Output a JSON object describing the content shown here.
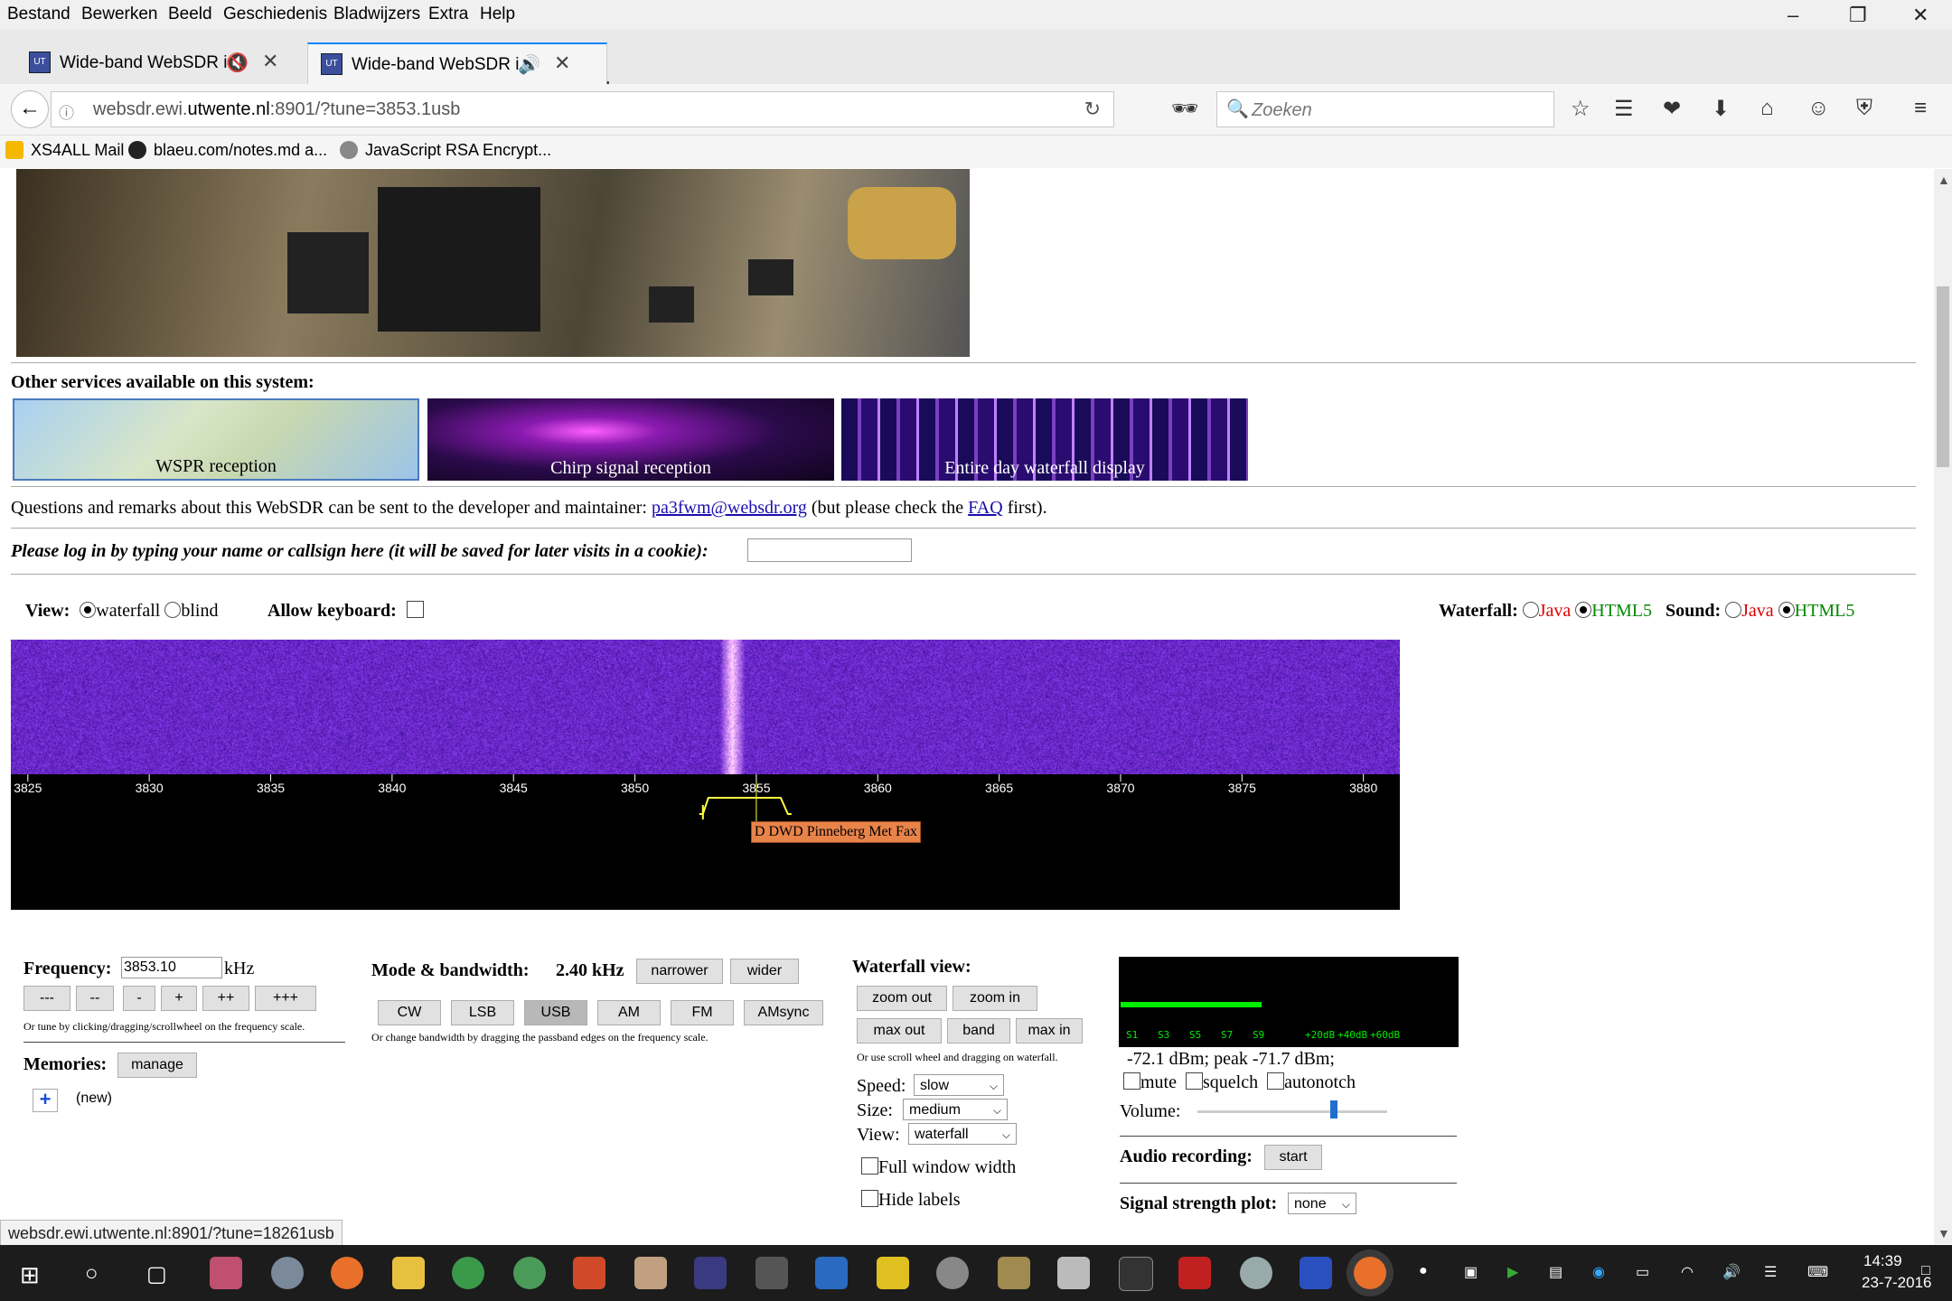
{
  "menubar": {
    "items": [
      "Bestand",
      "Bewerken",
      "Beeld",
      "Geschiedenis",
      "Bladwijzers",
      "Extra",
      "Help"
    ],
    "underline": [
      "B",
      "w",
      "B",
      "s",
      "B",
      "x",
      "H"
    ]
  },
  "tabs": [
    {
      "title": "Wide-band WebSDR i...",
      "audio_icon": "muted-speaker-icon"
    },
    {
      "title": "Wide-band WebSDR i...",
      "audio_icon": "speaker-icon"
    }
  ],
  "navbar": {
    "url_prefix": "websdr.ewi.",
    "url_domain": "utwente.nl",
    "url_suffix": ":8901/?tune=3853.1usb",
    "search_placeholder": "Zoeken"
  },
  "bookmarks": [
    {
      "label": "XS4ALL Mail",
      "icon": "xs4all-icon",
      "color": "#f5b800"
    },
    {
      "label": "blaeu.com/notes.md a...",
      "icon": "github-icon",
      "color": "#222222"
    },
    {
      "label": "JavaScript RSA Encrypt...",
      "icon": "globe-icon",
      "color": "#888888"
    }
  ],
  "page": {
    "other_services_heading": "Other services available on this system:",
    "services": [
      {
        "label": "WSPR reception",
        "color": "#a8c8e8"
      },
      {
        "label": "Chirp signal reception",
        "color": "#2a0a4a"
      },
      {
        "label": "Entire day waterfall display",
        "color": "#1a0a5a"
      }
    ],
    "contact_pre": "Questions and remarks about this WebSDR can be sent to the developer and maintainer: ",
    "contact_email": "pa3fwm@websdr.org",
    "contact_mid": " (but please check the ",
    "contact_faq": "FAQ",
    "contact_post": " first).",
    "login_prompt": "Please log in by typing your name or callsign here (it will be saved for later visits in a cookie):",
    "login_value": "",
    "view_label": "View:",
    "view_options": [
      "waterfall",
      "blind"
    ],
    "view_selected": "waterfall",
    "allow_keyboard_label": "Allow keyboard:",
    "allow_keyboard": false,
    "waterfall_label": "Waterfall:",
    "sound_label": "Sound:",
    "java_label": "Java",
    "html5_label": "HTML5",
    "waterfall_choice": "HTML5",
    "sound_choice": "HTML5"
  },
  "waterfall": {
    "signal_khz": 3854.0,
    "signal_color": "#fff6e0",
    "bg_color": "#5a1fb0",
    "accent_color": "#ffffff"
  },
  "scale": {
    "start_khz": 3824.3,
    "end_khz": 3881.5,
    "ticks": [
      3825,
      3830,
      3835,
      3840,
      3845,
      3850,
      3855,
      3860,
      3865,
      3870,
      3875,
      3880
    ],
    "tick_labels": [
      "3825",
      "3830",
      "3835",
      "3840",
      "3845",
      "3850",
      "3855",
      "3860",
      "3865",
      "3870",
      "3875",
      "3880"
    ],
    "passband_low_khz": 3852.8,
    "passband_high_khz": 3856.3,
    "tuned_khz": 3855.0,
    "station_label": "D DWD Pinneberg Met Fax",
    "station_color": "#e8834a",
    "passband_color": "#ffff40"
  },
  "frequency_panel": {
    "label": "Frequency:",
    "value": "3853.10",
    "unit": "kHz",
    "step_buttons": [
      "---",
      "--",
      "-",
      "+",
      "++",
      "+++"
    ],
    "hint": "Or tune by clicking/dragging/scrollwheel on the frequency scale.",
    "memories_label": "Memories:",
    "manage_button": "manage",
    "add_button": "+",
    "new_label": "(new)"
  },
  "mode_panel": {
    "label": "Mode & bandwidth:",
    "bandwidth": "2.40 kHz",
    "narrower": "narrower",
    "wider": "wider",
    "modes": [
      "CW",
      "LSB",
      "USB",
      "AM",
      "FM",
      "AMsync"
    ],
    "selected_mode": "USB",
    "hint": "Or change bandwidth by dragging the passband edges on the frequency scale."
  },
  "wfview_panel": {
    "label": "Waterfall view:",
    "buttons_row1": [
      "zoom out",
      "zoom in"
    ],
    "buttons_row2": [
      "max out",
      "band",
      "max in"
    ],
    "hint": "Or use scroll wheel and dragging on waterfall.",
    "speed_label": "Speed:",
    "speed_value": "slow",
    "size_label": "Size:",
    "size_value": "medium",
    "view_label": "View:",
    "view_value": "waterfall",
    "full_window_label": "Full window width",
    "hide_labels_label": "Hide labels",
    "full_window": false,
    "hide_labels": false
  },
  "audio_panel": {
    "smeter_fraction": 0.42,
    "smeter_color": "#00ee00",
    "smeter_labels": [
      "S1",
      "S3",
      "S5",
      "S7",
      "S9",
      "+20dB",
      "+40dB",
      "+60dB"
    ],
    "readout": "-72.1 dBm; peak  -71.7 dBm;",
    "mute_label": "mute",
    "squelch_label": "squelch",
    "autonotch_label": "autonotch",
    "volume_label": "Volume:",
    "volume_fraction": 0.72,
    "recording_label": "Audio recording:",
    "recording_button": "start",
    "strength_label": "Signal strength plot:",
    "strength_value": "none"
  },
  "status_url": "websdr.ewi.utwente.nl:8901/?tune=18261usb",
  "taskbar": {
    "time": "14:39",
    "date": "23-7-2016"
  }
}
